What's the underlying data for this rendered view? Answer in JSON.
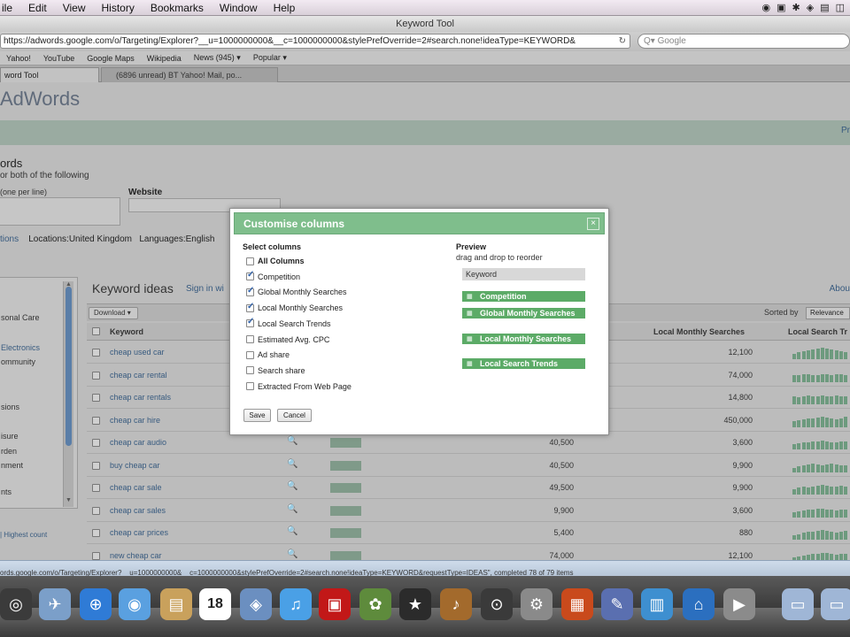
{
  "menubar": {
    "items": [
      "ile",
      "Edit",
      "View",
      "History",
      "Bookmarks",
      "Window",
      "Help"
    ],
    "tray": [
      "◉",
      "▣",
      "✱",
      "◈",
      "▤",
      "◫"
    ]
  },
  "window": {
    "title": "Keyword Tool"
  },
  "toolbar": {
    "url": "https://adwords.google.com/o/Targeting/Explorer?__u=1000000000&__c=1000000000&stylePrefOverride=2#search.none!ideaType=KEYWORD&",
    "search_placeholder": "Q▾ Google"
  },
  "bookmarks": [
    "Yahoo!",
    "YouTube",
    "Google Maps",
    "Wikipedia",
    "News (945) ▾",
    "Popular ▾"
  ],
  "tabs": [
    {
      "label": "word Tool"
    },
    {
      "label": "(6896 unread) BT Yahoo! Mail, po..."
    }
  ],
  "page": {
    "logo": "AdWords",
    "band_link": "Pr",
    "section_title": "ords",
    "section_sub": "or both of the following",
    "words_label": "(one per line)",
    "website_label": "Website",
    "options_link": "tions",
    "locations": "Locations:United Kingdom",
    "languages": "Languages:English",
    "categories": [
      {
        "label": "sonal Care",
        "link": false
      },
      {
        "label": "Electronics",
        "link": true
      },
      {
        "label": "ommunity",
        "link": false
      },
      {
        "label": "sions",
        "link": false
      },
      {
        "label": "isure",
        "link": false
      },
      {
        "label": "rden",
        "link": false
      },
      {
        "label": "nment",
        "link": false
      },
      {
        "label": "nts",
        "link": false
      }
    ],
    "highest_count": "| Highest count",
    "ideas_title": "Keyword ideas",
    "sign_in": "Sign in wi",
    "about": "Abou",
    "download": "Download ▾",
    "sorted_by": "Sorted by",
    "sort_value": "Relevance",
    "headers": {
      "keyword": "Keyword",
      "local_monthly": "Local Monthly Searches",
      "local_trends": "Local Search Tr"
    },
    "rows": [
      {
        "keyword": "cheap used car",
        "global": "",
        "local": "12,100"
      },
      {
        "keyword": "cheap car rental",
        "global": "",
        "local": "74,000"
      },
      {
        "keyword": "cheap car rentals",
        "global": "",
        "local": "14,800"
      },
      {
        "keyword": "cheap car hire",
        "global": "",
        "local": "450,000"
      },
      {
        "keyword": "cheap car audio",
        "global": "40,500",
        "local": "3,600"
      },
      {
        "keyword": "buy cheap car",
        "global": "40,500",
        "local": "9,900"
      },
      {
        "keyword": "cheap car sale",
        "global": "49,500",
        "local": "9,900"
      },
      {
        "keyword": "cheap car sales",
        "global": "9,900",
        "local": "3,600"
      },
      {
        "keyword": "cheap car prices",
        "global": "5,400",
        "local": "880"
      },
      {
        "keyword": "new cheap car",
        "global": "74,000",
        "local": "12,100"
      }
    ]
  },
  "dialog": {
    "title": "Customise columns",
    "close": "×",
    "select_label": "Select columns",
    "options": [
      {
        "label": "All Columns",
        "checked": false,
        "bold": true
      },
      {
        "label": "Competition",
        "checked": true,
        "bold": false
      },
      {
        "label": "Global Monthly Searches",
        "checked": true,
        "bold": false
      },
      {
        "label": "Local Monthly Searches",
        "checked": true,
        "bold": false
      },
      {
        "label": "Local Search Trends",
        "checked": true,
        "bold": false
      },
      {
        "label": "Estimated Avg. CPC",
        "checked": false,
        "bold": false
      },
      {
        "label": "Ad share",
        "checked": false,
        "bold": false
      },
      {
        "label": "Search share",
        "checked": false,
        "bold": false
      },
      {
        "label": "Extracted From Web Page",
        "checked": false,
        "bold": false
      }
    ],
    "preview_label": "Preview",
    "preview_sub": "drag and drop to reorder",
    "preview_keyword": "Keyword",
    "preview_items": [
      "Competition",
      "Global Monthly Searches",
      "Local Monthly Searches",
      "Local Search Trends"
    ],
    "save": "Save",
    "cancel": "Cancel"
  },
  "status": {
    "text": "ords.google.com/o/Targeting/Explorer?__u=1000000000&__c=1000000000&stylePrefOverride=2#search.none!ideaType=KEYWORD&requestType=IDEAS\", completed 78 of 79 items"
  },
  "dock": {
    "icons": [
      "disc-icon",
      "preview-icon",
      "safari-icon",
      "facetime-icon",
      "address-book-icon",
      "calendar-icon",
      "photos-icon",
      "itunes-icon",
      "photo-booth-icon",
      "iphoto-icon",
      "imovie-icon",
      "garageband-icon",
      "time-machine-icon",
      "system-prefs-icon",
      "keynote-icon",
      "pen-icon",
      "charts-icon",
      "home-icon",
      "media-icon",
      "folder-icon",
      "folder-icon"
    ],
    "calendar_day": "18",
    "icon_colors": [
      "#3b3b3b",
      "#7b9fc9",
      "#2f7bd6",
      "#5aa0e0",
      "#c9a15c",
      "#ffffff",
      "#6b8fc0",
      "#4aa0e6",
      "#c21818",
      "#5e8b3c",
      "#2b2b2b",
      "#a36a2c",
      "#3a3a3a",
      "#8a8a8a",
      "#c94a1c",
      "#5a6fb0",
      "#3e8fd0",
      "#2b6fbf",
      "#8b8b8b",
      "#9fb6d6",
      "#9fb6d6"
    ]
  }
}
